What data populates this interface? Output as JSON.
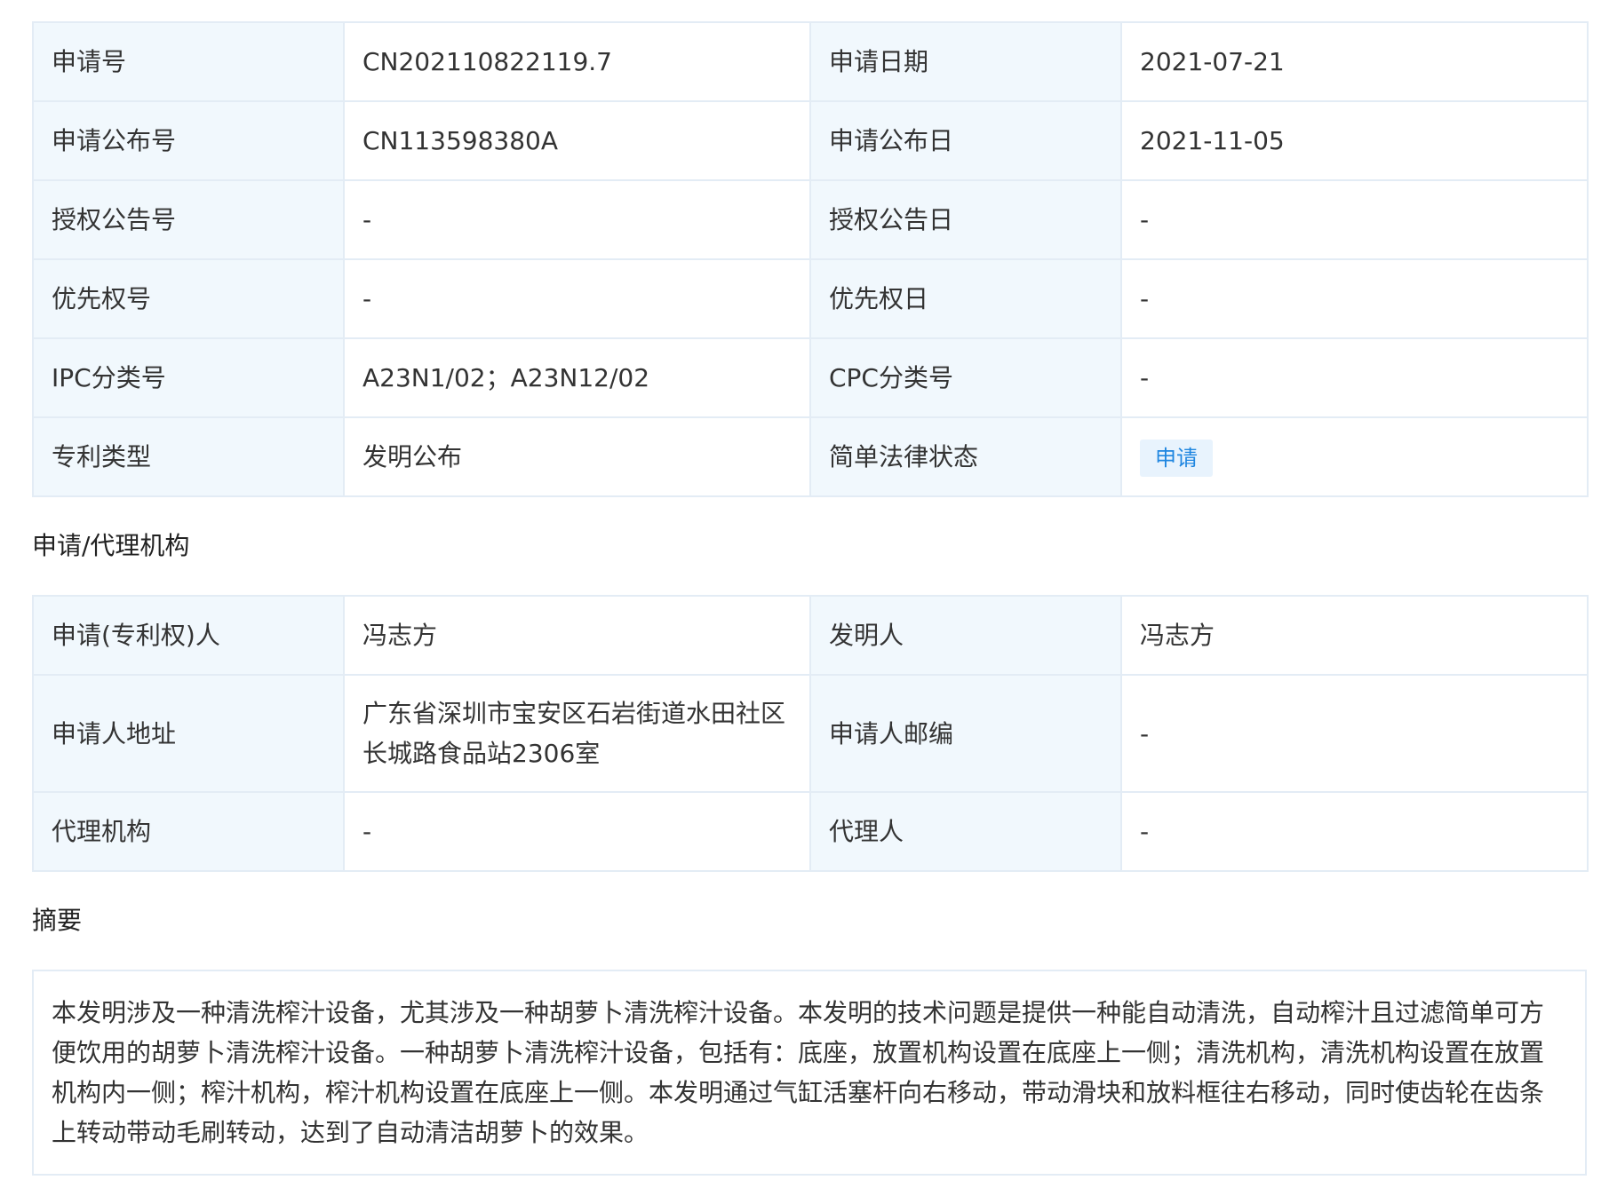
{
  "basic_info": [
    {
      "label_left": "申请号",
      "value_left": "CN202110822119.7",
      "label_right": "申请日期",
      "value_right": "2021-07-21"
    },
    {
      "label_left": "申请公布号",
      "value_left": "CN113598380A",
      "label_right": "申请公布日",
      "value_right": "2021-11-05"
    },
    {
      "label_left": "授权公告号",
      "value_left": "-",
      "label_right": "授权公告日",
      "value_right": "-"
    },
    {
      "label_left": "优先权号",
      "value_left": "-",
      "label_right": "优先权日",
      "value_right": "-"
    },
    {
      "label_left": "IPC分类号",
      "value_left": "A23N1/02；A23N12/02",
      "label_right": "CPC分类号",
      "value_right": "-"
    },
    {
      "label_left": "专利类型",
      "value_left": "发明公布",
      "label_right": "简单法律状态",
      "value_right": "申请"
    }
  ],
  "agency_section": {
    "title": "申请/代理机构",
    "rows": [
      {
        "label_left": "申请(专利权)人",
        "value_left": "冯志方",
        "label_right": "发明人",
        "value_right": "冯志方"
      },
      {
        "label_left": "申请人地址",
        "value_left": "广东省深圳市宝安区石岩街道水田社区长城路食品站2306室",
        "label_right": "申请人邮编",
        "value_right": "-"
      },
      {
        "label_left": "代理机构",
        "value_left": "-",
        "label_right": "代理人",
        "value_right": "-"
      }
    ]
  },
  "abstract_section": {
    "title": "摘要",
    "text": "本发明涉及一种清洗榨汁设备，尤其涉及一种胡萝卜清洗榨汁设备。本发明的技术问题是提供一种能自动清洗，自动榨汁且过滤简单可方便饮用的胡萝卜清洗榨汁设备。一种胡萝卜清洗榨汁设备，包括有：底座，放置机构设置在底座上一侧；清洗机构，清洗机构设置在放置机构内一侧；榨汁机构，榨汁机构设置在底座上一侧。本发明通过气缸活塞杆向右移动，带动滑块和放料框往右移动，同时使齿轮在齿条上转动带动毛刷转动，达到了自动清洁胡萝卜的效果。"
  },
  "colors": {
    "label_bg": "#f1f8fd",
    "border": "#e3ecf5",
    "badge_bg": "#e8f3fd",
    "badge_text": "#1f86e0"
  }
}
